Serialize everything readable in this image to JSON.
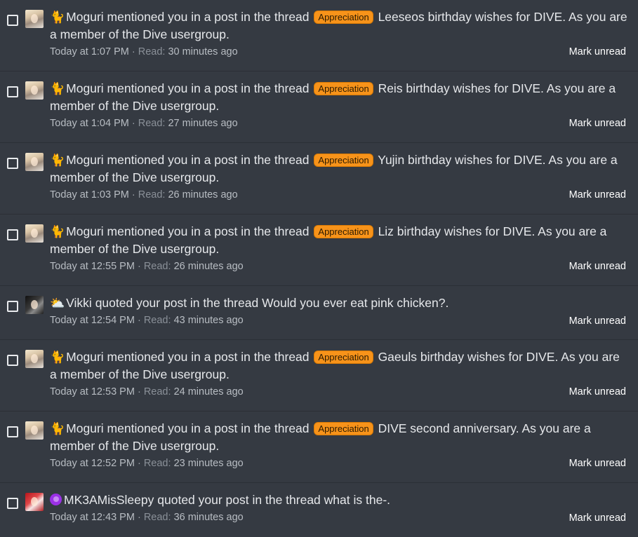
{
  "strings": {
    "mentioned": "mentioned you in a post in the thread",
    "quoted": "quoted your post in the thread",
    "read_label": "Read:",
    "mark_unread": "Mark unread",
    "dot_sep": "·"
  },
  "colors": {
    "background": "#353a42",
    "badge": "#f7931a",
    "text": "#e6e8eb",
    "muted": "#9ba1a8"
  },
  "alerts": [
    {
      "type": "mention",
      "user": "Moguri",
      "user_icon": "cat-emoji-icon",
      "avatar": "moguri",
      "label": "Appreciation",
      "thread": "Leeseos birthday wishes for DIVE",
      "suffix": ". As you are a member of the Dive usergroup.",
      "date": "Today at 1:07 PM",
      "read": "30 minutes ago"
    },
    {
      "type": "mention",
      "user": "Moguri",
      "user_icon": "cat-emoji-icon",
      "avatar": "moguri",
      "label": "Appreciation",
      "thread": "Reis birthday wishes for DIVE",
      "suffix": ". As you are a member of the Dive usergroup.",
      "date": "Today at 1:04 PM",
      "read": "27 minutes ago"
    },
    {
      "type": "mention",
      "user": "Moguri",
      "user_icon": "cat-emoji-icon",
      "avatar": "moguri",
      "label": "Appreciation",
      "thread": "Yujin birthday wishes for DIVE",
      "suffix": ". As you are a member of the Dive usergroup.",
      "date": "Today at 1:03 PM",
      "read": "26 minutes ago"
    },
    {
      "type": "mention",
      "user": "Moguri",
      "user_icon": "cat-emoji-icon",
      "avatar": "moguri",
      "label": "Appreciation",
      "thread": "Liz birthday wishes for DIVE",
      "suffix": ". As you are a member of the Dive usergroup.",
      "date": "Today at 12:55 PM",
      "read": "26 minutes ago"
    },
    {
      "type": "quote",
      "user": "Vikki",
      "user_icon": "sun-cloud-emoji-icon",
      "avatar": "vikki",
      "label": "",
      "thread": "Would you ever eat pink chicken?",
      "suffix": ".",
      "date": "Today at 12:54 PM",
      "read": "43 minutes ago"
    },
    {
      "type": "mention",
      "user": "Moguri",
      "user_icon": "cat-emoji-icon",
      "avatar": "moguri",
      "label": "Appreciation",
      "thread": "Gaeuls birthday wishes for DIVE",
      "suffix": ". As you are a member of the Dive usergroup.",
      "date": "Today at 12:53 PM",
      "read": "24 minutes ago"
    },
    {
      "type": "mention",
      "user": "Moguri",
      "user_icon": "cat-emoji-icon",
      "avatar": "moguri",
      "label": "Appreciation",
      "thread": "DIVE second anniversary",
      "suffix": ". As you are a member of the Dive usergroup.",
      "date": "Today at 12:52 PM",
      "read": "23 minutes ago"
    },
    {
      "type": "quote",
      "user": "MK3AMisSleepy",
      "user_icon": "purple-moon-emoji-icon",
      "avatar": "mk3",
      "label": "",
      "thread": "what is the-",
      "suffix": ".",
      "date": "Today at 12:43 PM",
      "read": "36 minutes ago"
    }
  ]
}
